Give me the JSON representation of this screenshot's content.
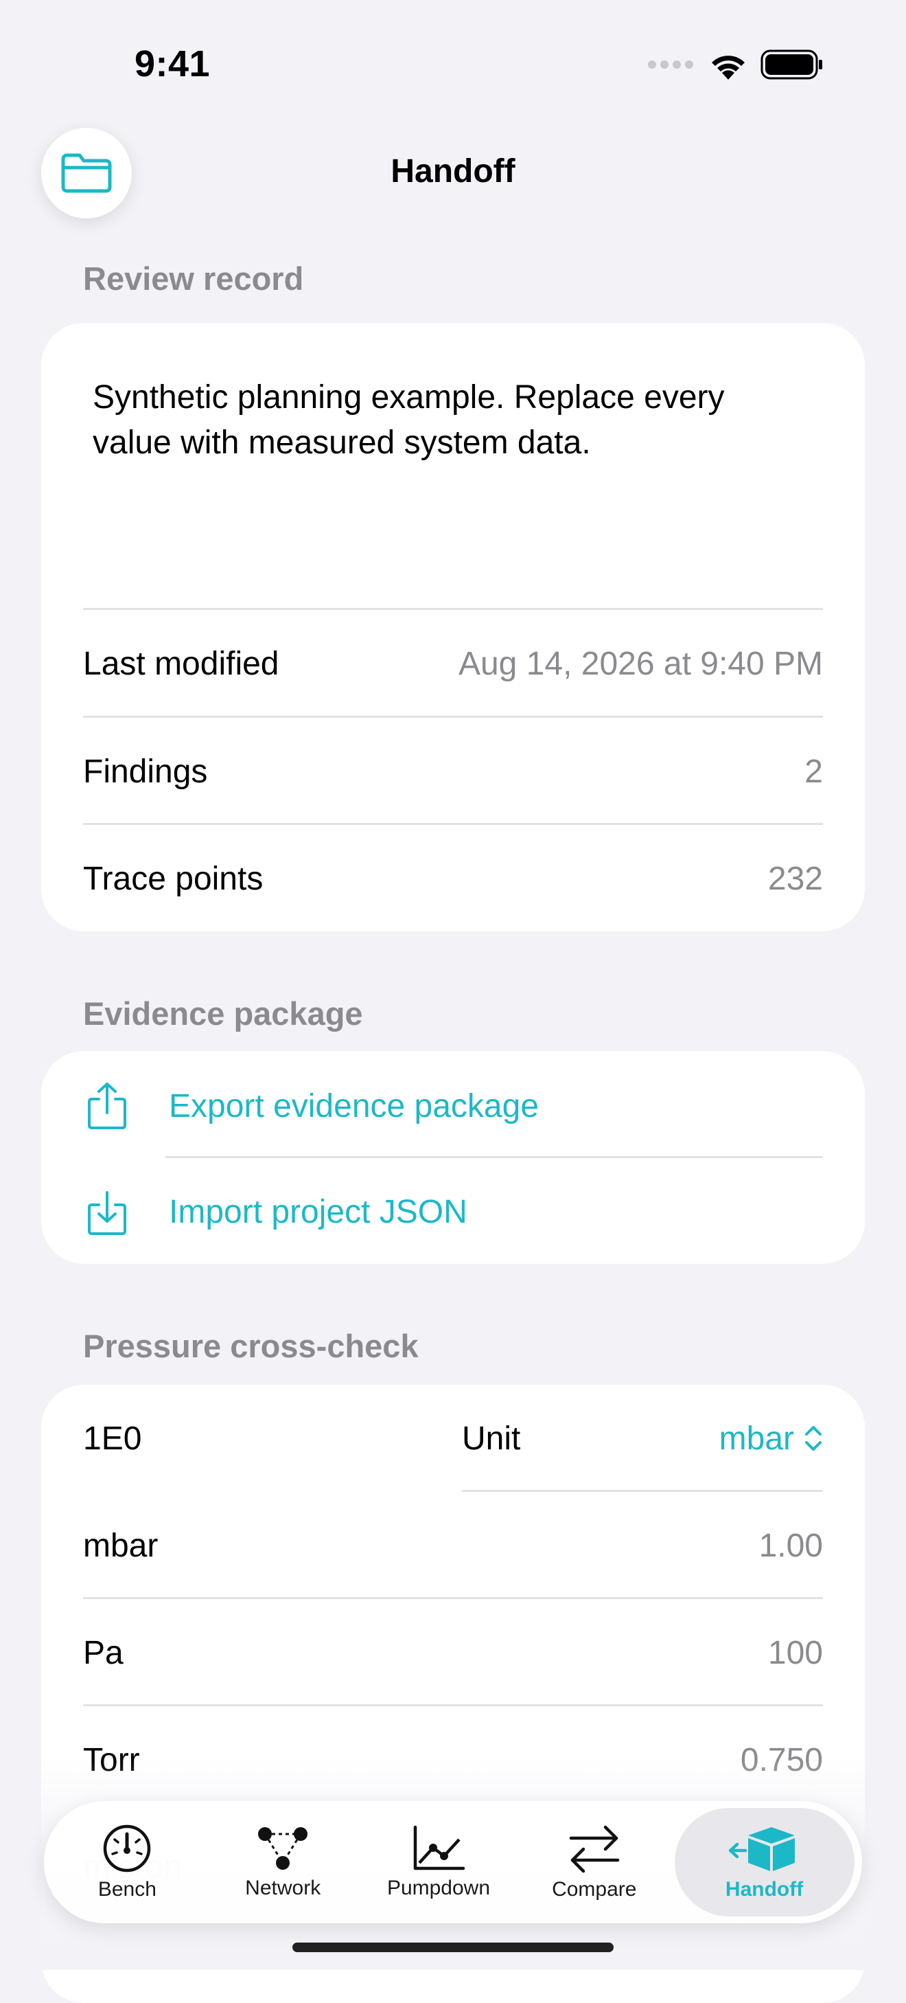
{
  "status_bar": {
    "time": "9:41"
  },
  "nav": {
    "title": "Handoff",
    "leading_icon": "folder-icon"
  },
  "review_record": {
    "header": "Review record",
    "note": "Synthetic planning example. Replace every value with measured system data.",
    "rows": [
      {
        "label": "Last modified",
        "value": "Aug 14, 2026 at 9:40 PM"
      },
      {
        "label": "Findings",
        "value": "2"
      },
      {
        "label": "Trace points",
        "value": "232"
      }
    ]
  },
  "evidence_package": {
    "header": "Evidence package",
    "actions": [
      {
        "label": "Export evidence package",
        "icon": "share-icon"
      },
      {
        "label": "Import project JSON",
        "icon": "import-icon"
      }
    ]
  },
  "pressure_crosscheck": {
    "header": "Pressure cross-check",
    "input_value": "1E0",
    "unit_label": "Unit",
    "unit_value": "mbar",
    "rows": [
      {
        "label": "mbar",
        "value": "1.00"
      },
      {
        "label": "Pa",
        "value": "100"
      },
      {
        "label": "Torr",
        "value": "0.750"
      },
      {
        "label": "micron",
        "value": ""
      }
    ]
  },
  "tab_bar": {
    "tabs": [
      {
        "label": "Bench",
        "icon": "gauge-icon",
        "active": false
      },
      {
        "label": "Network",
        "icon": "network-icon",
        "active": false
      },
      {
        "label": "Pumpdown",
        "icon": "line-chart-icon",
        "active": false
      },
      {
        "label": "Compare",
        "icon": "arrows-swap-icon",
        "active": false
      },
      {
        "label": "Handoff",
        "icon": "package-icon",
        "active": true
      }
    ]
  },
  "colors": {
    "accent": "#1cb8c8",
    "background": "#f2f2f7",
    "secondary_text": "#8a8a8f"
  }
}
